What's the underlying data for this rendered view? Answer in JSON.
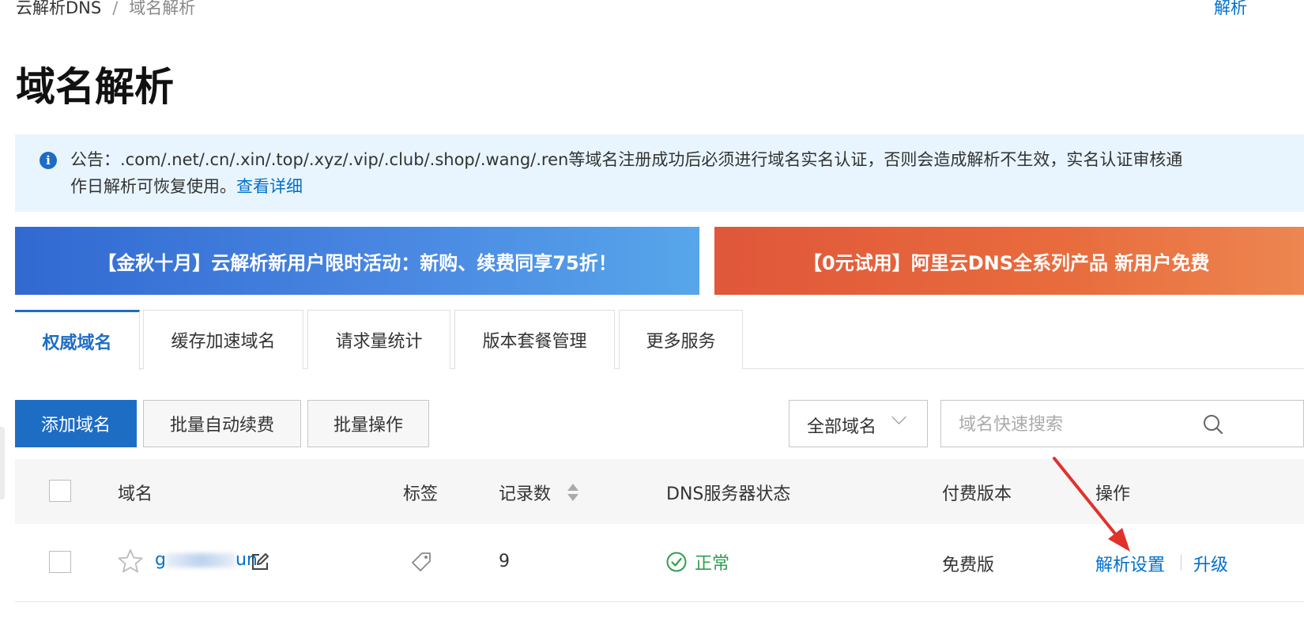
{
  "breadcrumb": {
    "root": "云解析DNS",
    "separator": "/",
    "current": "域名解析"
  },
  "top_right_link": "解析",
  "page_title": "域名解析",
  "notice": {
    "line1": "公告：.com/.net/.cn/.xin/.top/.xyz/.vip/.club/.shop/.wang/.ren等域名注册成功后必须进行域名实名认证，否则会造成解析不生效，实名认证审核通",
    "line2": "作日解析可恢复使用。",
    "link": "查看详细"
  },
  "banners": {
    "left": "【金秋十月】云解析新用户限时活动：新购、续费同享75折！",
    "right": "【0元试用】阿里云DNS全系列产品 新用户免费"
  },
  "tabs": [
    "权威域名",
    "缓存加速域名",
    "请求量统计",
    "版本套餐管理",
    "更多服务"
  ],
  "toolbar": {
    "add_domain": "添加域名",
    "batch_renew": "批量自动续费",
    "batch_ops": "批量操作",
    "filter_selected": "全部域名",
    "search_placeholder": "域名快速搜索"
  },
  "table": {
    "headers": {
      "domain": "域名",
      "tag": "标签",
      "records": "记录数",
      "dns_status": "DNS服务器状态",
      "edition": "付费版本",
      "actions": "操作"
    },
    "rows": [
      {
        "domain_prefix": "g",
        "domain_suffix": "un",
        "records": "9",
        "dns_status": "正常",
        "edition": "免费版",
        "action_settings": "解析设置",
        "action_upgrade": "升级"
      }
    ]
  },
  "colors": {
    "primary": "#1e6dc4",
    "link": "#0070cc",
    "success": "#2e9e4e",
    "arrow": "#e0322a"
  }
}
